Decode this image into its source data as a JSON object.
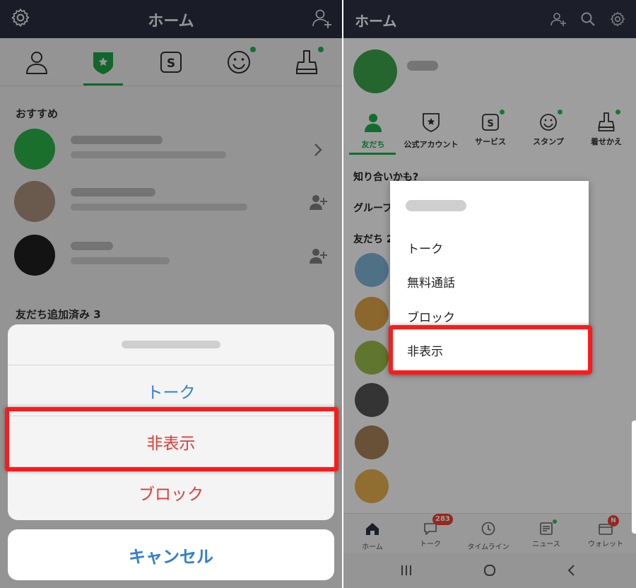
{
  "left": {
    "header": {
      "title": "ホーム",
      "settings_icon": "gear-icon",
      "add_friend_icon": "person-add-icon"
    },
    "tabs": [
      {
        "icon": "person-icon",
        "active": false,
        "dot": false
      },
      {
        "icon": "official-shield-icon",
        "active": true,
        "dot": false
      },
      {
        "icon": "service-s-icon",
        "active": false,
        "dot": false
      },
      {
        "icon": "sticker-smile-icon",
        "active": false,
        "dot": true
      },
      {
        "icon": "theme-brush-icon",
        "active": false,
        "dot": true
      }
    ],
    "recommended_label": "おすすめ",
    "added_label": "友だち追加済み 3",
    "action_sheet": {
      "talk": "トーク",
      "hide": "非表示",
      "block": "ブロック",
      "cancel": "キャンセル"
    },
    "colors": {
      "header": "#2e3244",
      "accent_green": "#1fb04a",
      "ios_blue": "#2f7ed8",
      "ios_red": "#e53935",
      "highlight": "#ff1a1a"
    }
  },
  "right": {
    "header": {
      "title": "ホーム",
      "icons": [
        "person-add-icon",
        "search-icon",
        "gear-icon"
      ]
    },
    "tabs": [
      {
        "label": "友だち",
        "icon": "friends-icon",
        "active": true,
        "dot": false
      },
      {
        "label": "公式アカウント",
        "icon": "official-shield-icon",
        "active": false,
        "dot": false
      },
      {
        "label": "サービス",
        "icon": "service-s-icon",
        "active": false,
        "dot": true
      },
      {
        "label": "スタンプ",
        "icon": "sticker-smile-icon",
        "active": false,
        "dot": true
      },
      {
        "label": "着せかえ",
        "icon": "theme-brush-icon",
        "active": false,
        "dot": true
      }
    ],
    "sections": {
      "maybe_know": "知り合いかも?",
      "groups": "グループ",
      "friends": "友だち 2"
    },
    "context_menu": {
      "items": [
        "トーク",
        "無料通話",
        "ブロック",
        "非表示"
      ]
    },
    "bottom_nav": [
      {
        "label": "ホーム",
        "icon": "home-icon",
        "active": true
      },
      {
        "label": "トーク",
        "icon": "chat-bubble-icon",
        "badge": "283"
      },
      {
        "label": "タイムライン",
        "icon": "clock-icon"
      },
      {
        "label": "ニュース",
        "icon": "news-icon",
        "dot": true
      },
      {
        "label": "ウォレット",
        "icon": "wallet-icon",
        "badge": "N"
      }
    ],
    "system_nav": [
      "recent-apps-icon",
      "home-circle-icon",
      "back-chevron-icon"
    ]
  }
}
